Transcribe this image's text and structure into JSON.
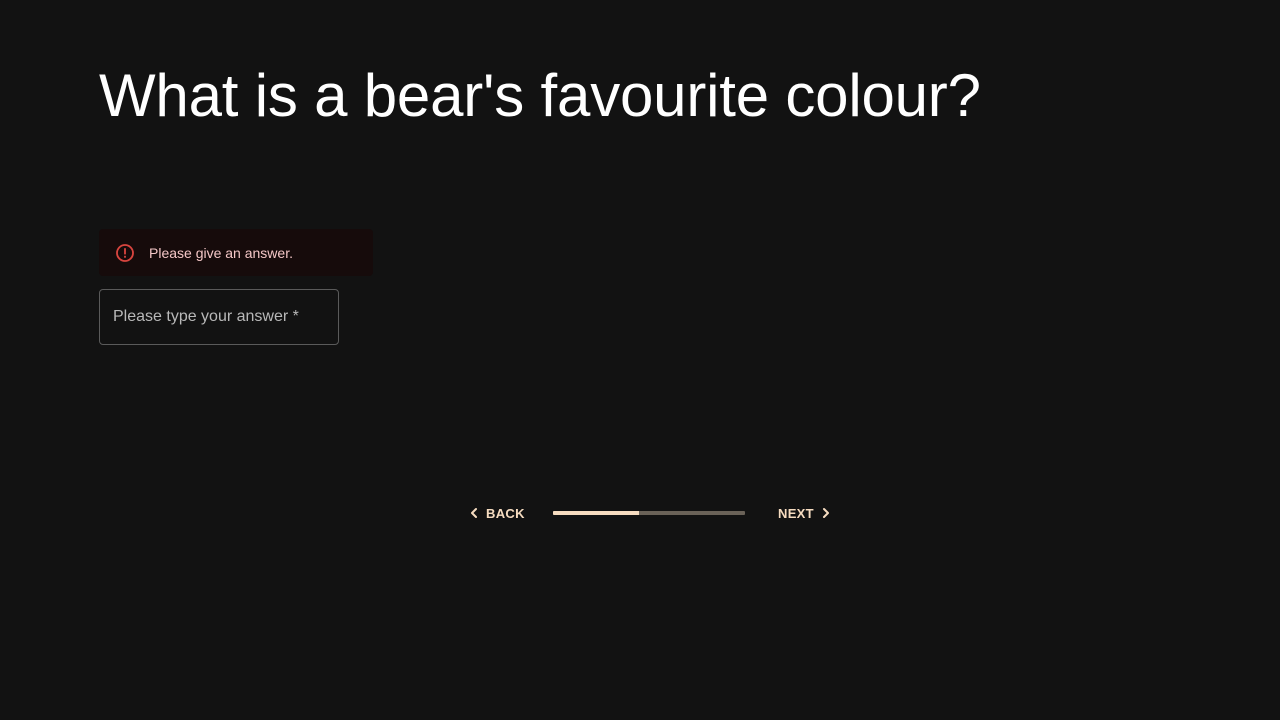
{
  "question": {
    "title": "What is a bear's favourite colour?"
  },
  "alert": {
    "icon": "error-icon",
    "message": "Please give an answer.",
    "color": "#d9453f"
  },
  "answer_field": {
    "label": "Please type your answer *",
    "value": ""
  },
  "navigation": {
    "back_label": "BACK",
    "next_label": "NEXT",
    "back_icon": "chevron-left-icon",
    "next_icon": "chevron-right-icon",
    "progress_fraction": 0.45,
    "accent_color": "#f6dcc0"
  }
}
